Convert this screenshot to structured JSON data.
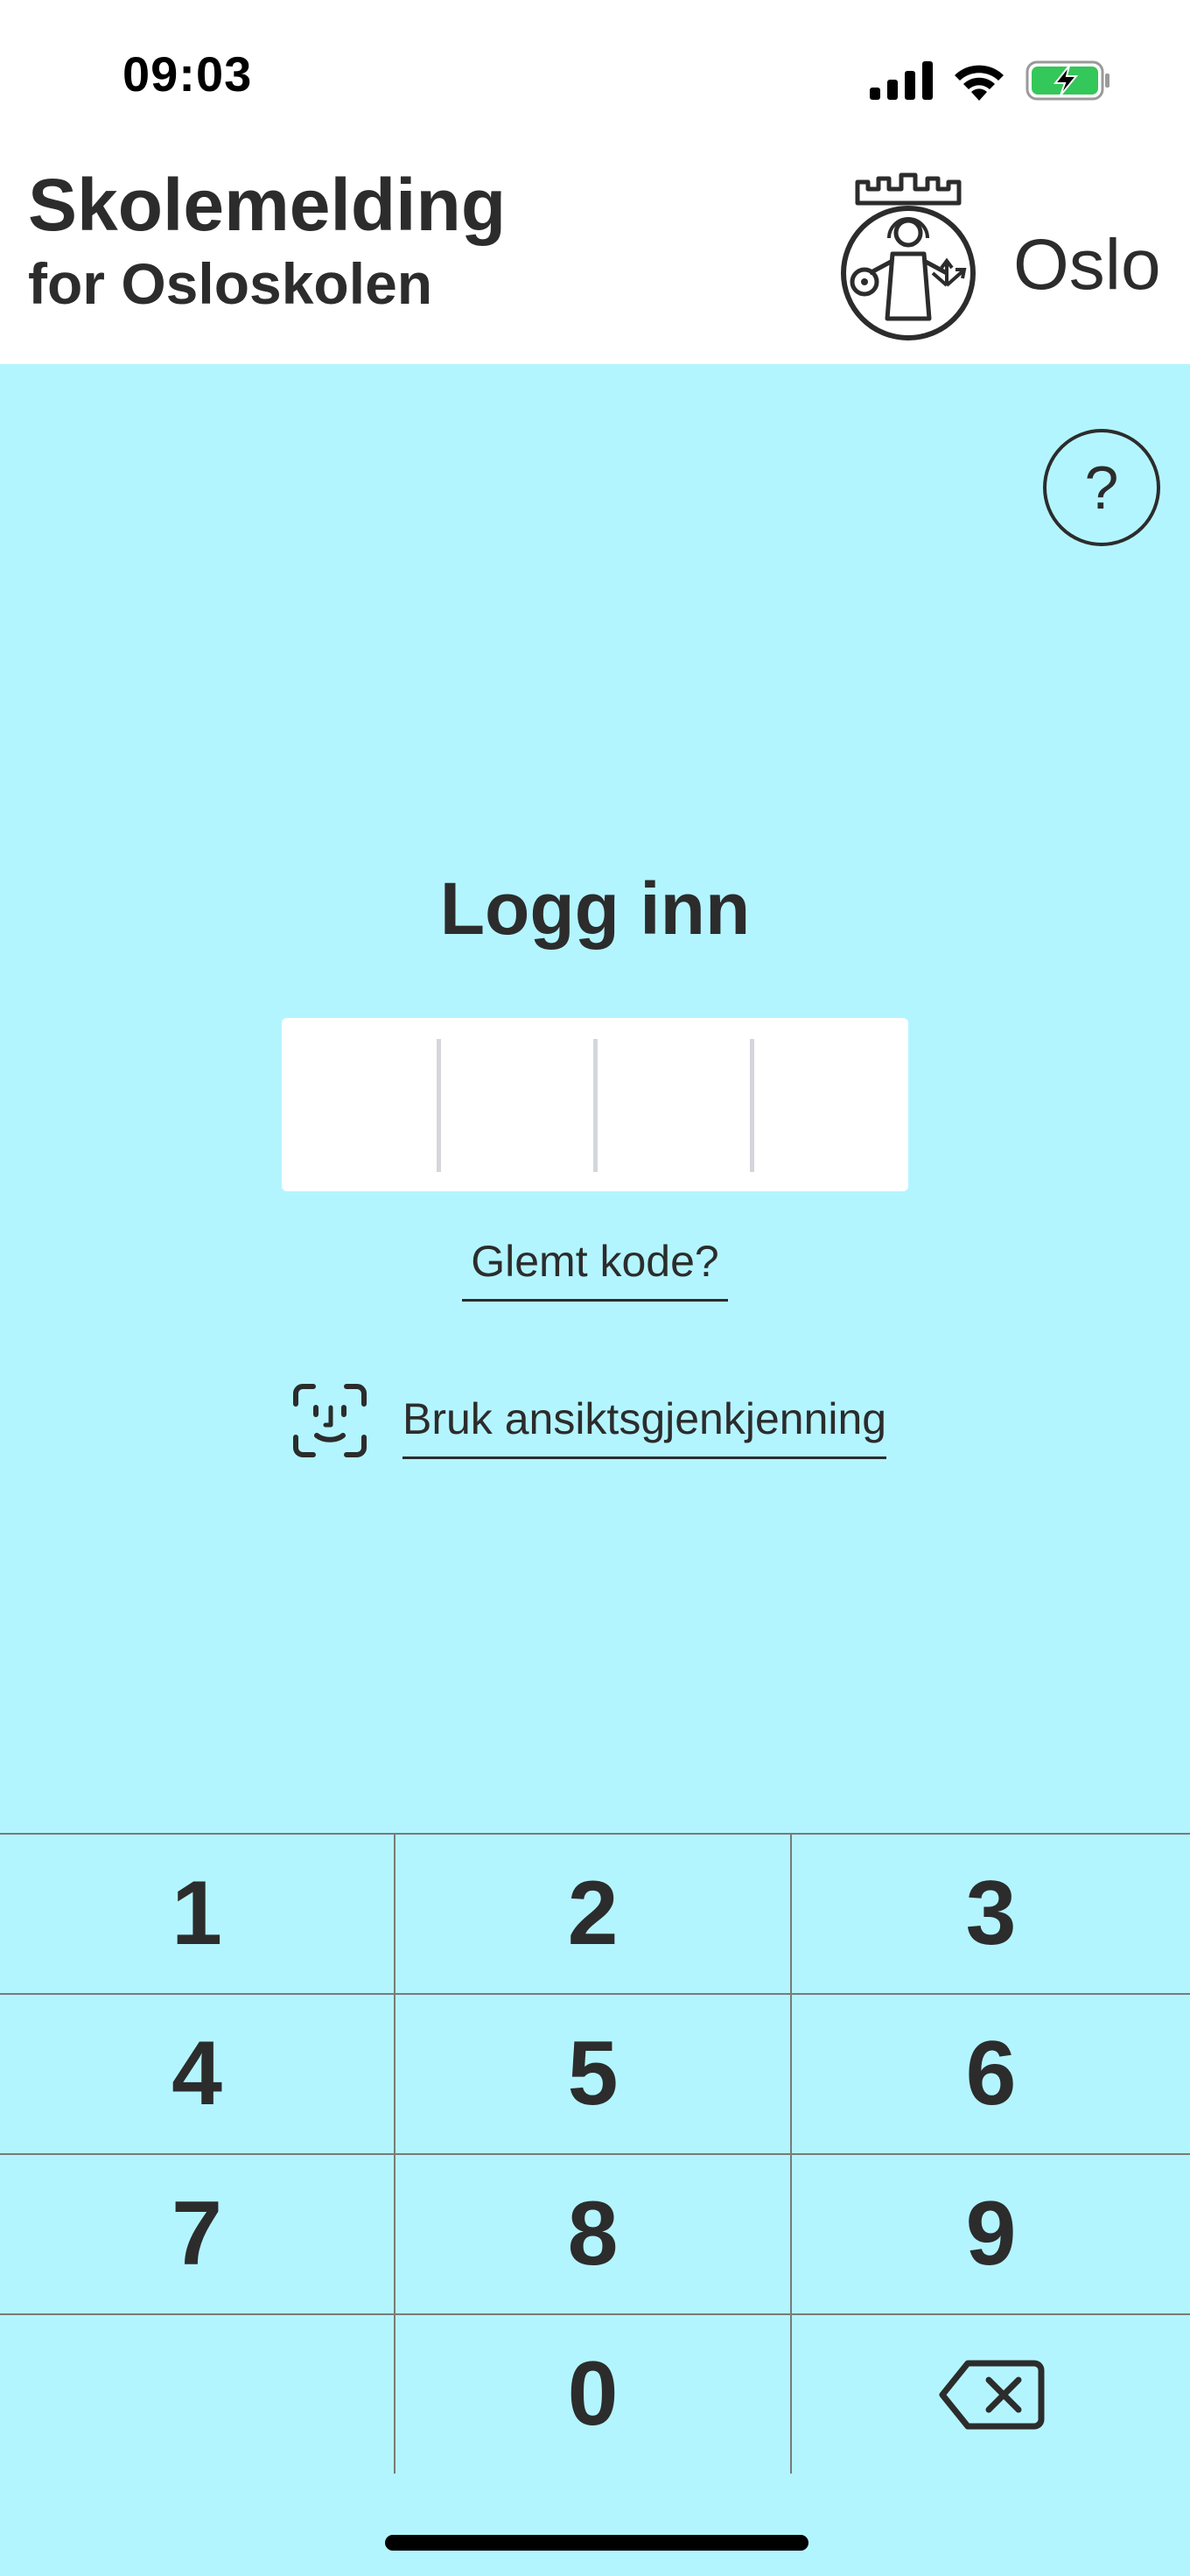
{
  "status_bar": {
    "time": "09:03",
    "icons": [
      "cellular-signal-icon",
      "wifi-icon",
      "battery-charging-icon"
    ]
  },
  "header": {
    "title": "Skolemelding",
    "subtitle": "for Osloskolen",
    "logo_text": "Oslo",
    "logo_icon": "oslo-coat-of-arms-icon"
  },
  "help": {
    "label": "?"
  },
  "login": {
    "title": "Logg inn",
    "pin_length": 4,
    "forgot_label": "Glemt kode?",
    "faceid_label": "Bruk ansiktsgjenkjenning",
    "faceid_icon": "face-id-icon"
  },
  "keypad": {
    "keys": [
      "1",
      "2",
      "3",
      "4",
      "5",
      "6",
      "7",
      "8",
      "9",
      "",
      "0",
      ""
    ],
    "delete_icon": "backspace-icon"
  },
  "colors": {
    "background": "#b3f5ff",
    "header_background": "#ffffff",
    "text": "#2c2c2c",
    "battery_green": "#34c759"
  }
}
